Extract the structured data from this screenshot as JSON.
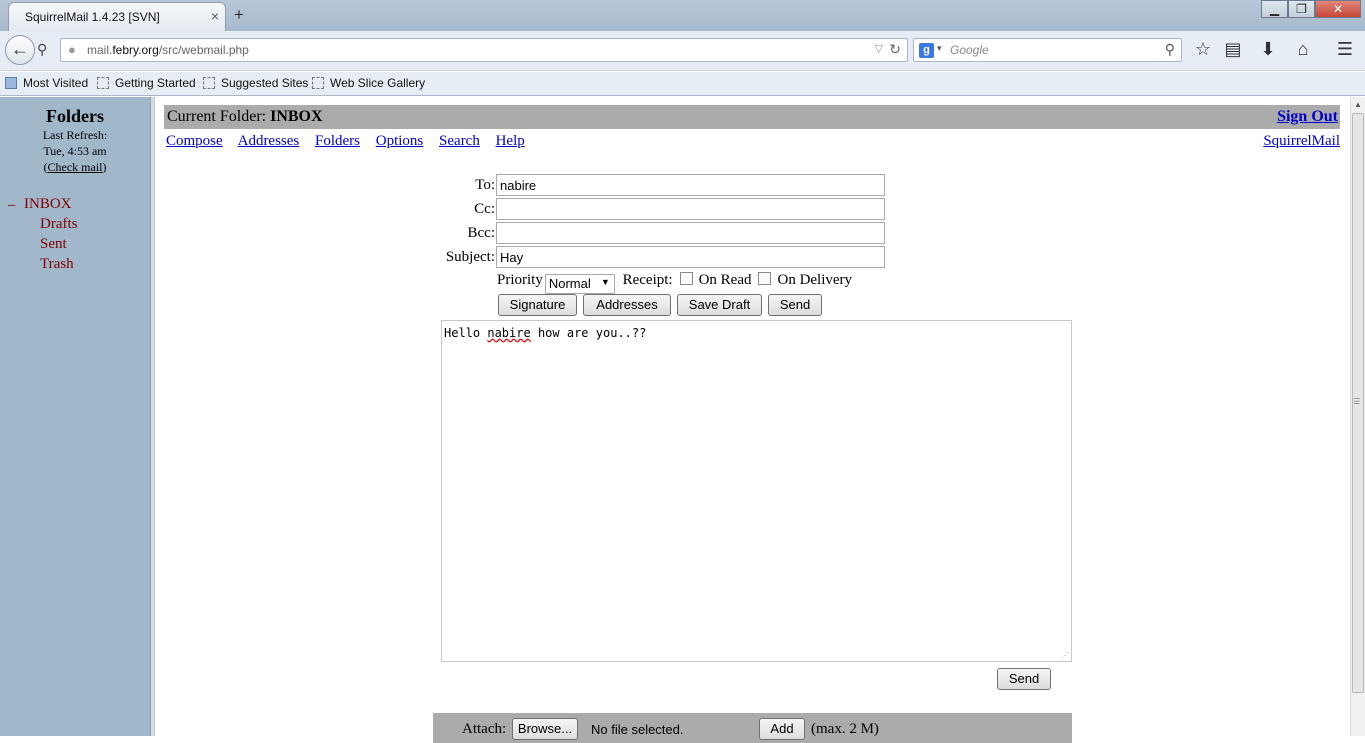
{
  "browser": {
    "tab_title": "SquirrelMail 1.4.23 [SVN]",
    "tab_close": "×",
    "new_tab": "+",
    "win_min": "▁",
    "win_max": "❐",
    "win_close": "✕",
    "url_domain_prefix": "mail.",
    "url_domain": "febry.org",
    "url_path": "/src/webmail.php",
    "search_placeholder": "Google",
    "bookmarks": [
      "Most Visited",
      "Getting Started",
      "Suggested Sites",
      "Web Slice Gallery"
    ]
  },
  "folders": {
    "title": "Folders",
    "last_refresh_label": "Last Refresh:",
    "last_refresh_time": "Tue, 4:53 am",
    "check_mail_open": "(",
    "check_mail": "Check mail",
    "check_mail_close": ")",
    "collapse": "–",
    "items": [
      "INBOX",
      "Drafts",
      "Sent",
      "Trash"
    ]
  },
  "header": {
    "current_folder_label": "Current Folder:",
    "current_folder": "INBOX",
    "sign_out": "Sign Out",
    "menu": [
      "Compose",
      "Addresses",
      "Folders",
      "Options",
      "Search",
      "Help"
    ],
    "squirrelmail_link": "SquirrelMail"
  },
  "compose": {
    "to_label": "To:",
    "to_value": "nabire",
    "cc_label": "Cc:",
    "cc_value": "",
    "bcc_label": "Bcc:",
    "bcc_value": "",
    "subject_label": "Subject:",
    "subject_value": "Hay",
    "priority_label": "Priority",
    "priority_value": "Normal",
    "receipt_label": "Receipt:",
    "on_read": "On Read",
    "on_delivery": "On Delivery",
    "buttons": {
      "signature": "Signature",
      "addresses": "Addresses",
      "save_draft": "Save Draft",
      "send": "Send"
    },
    "body_pre": "Hello ",
    "body_misspelled": "nabire",
    "body_post": " how are you..??",
    "send_bottom": "Send",
    "attach_label": "Attach:",
    "browse": "Browse...",
    "no_file": "No file selected.",
    "add": "Add",
    "max_size": "(max. 2 M)"
  }
}
